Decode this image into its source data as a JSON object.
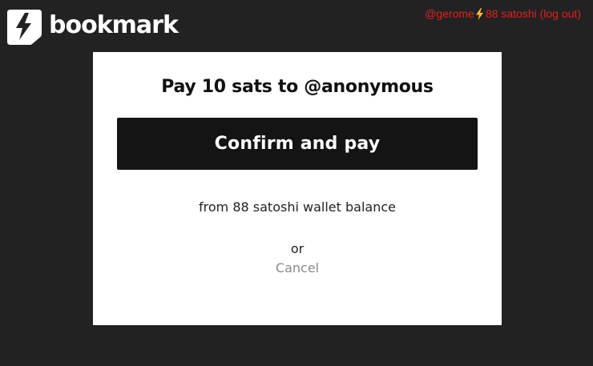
{
  "brand": {
    "name": "bookmark",
    "logo_icon": "bolt-shield-icon"
  },
  "user": {
    "handle": "@gerome",
    "balance": "88 satoshi",
    "logout_open": "(",
    "logout_label": "log out",
    "logout_close": ")"
  },
  "colors": {
    "background": "#222222",
    "accent_red": "#e02020",
    "modal_bg": "#ffffff",
    "button_bg": "#141414",
    "cancel_gray": "#8a8a8a"
  },
  "payment": {
    "title": "Pay 10 sats to @anonymous",
    "confirm_label": "Confirm and pay",
    "balance_note": "from 88 satoshi wallet balance",
    "or_text": "or",
    "cancel_label": "Cancel"
  }
}
